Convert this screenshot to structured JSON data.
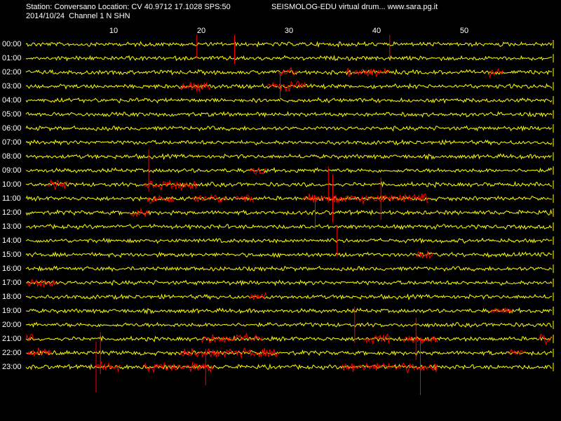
{
  "header": {
    "station_line": "Station: Conversano Location: CV 40.9712 17.1028 SPS:50",
    "site_line": "SEISMOLOG-EDU virtual drum... www.sara.pg.it",
    "date_line": "2014/10/24  Channel 1 N SHN"
  },
  "colors": {
    "background": "#000000",
    "trace_normal": "#FFFF00",
    "trace_event": "#FF0000",
    "text": "#FFFFFF"
  },
  "chart_data": {
    "type": "line",
    "xlabel": "",
    "ylabel": "",
    "x_unit": "minute",
    "xlim": [
      0,
      60
    ],
    "x_ticks": [
      10,
      20,
      30,
      40,
      50
    ],
    "x_tick_labels": [
      "10",
      "20",
      "30",
      "40",
      "50"
    ],
    "hour_labels": [
      "00:00",
      "01:00",
      "02:00",
      "03:00",
      "04:00",
      "05:00",
      "06:00",
      "07:00",
      "08:00",
      "09:00",
      "10:00",
      "11:00",
      "12:00",
      "13:00",
      "14:00",
      "15:00",
      "16:00",
      "17:00",
      "18:00",
      "19:00",
      "20:00",
      "21:00",
      "22:00",
      "23:00"
    ],
    "grid": false,
    "event_segments": [
      {
        "hour": 2,
        "start": 28.8,
        "end": 31.0
      },
      {
        "hour": 2,
        "start": 36.5,
        "end": 41.5
      },
      {
        "hour": 2,
        "start": 52.8,
        "end": 54.5
      },
      {
        "hour": 3,
        "start": 17.6,
        "end": 21.0
      },
      {
        "hour": 3,
        "start": 27.5,
        "end": 32.0
      },
      {
        "hour": 9,
        "start": 25.5,
        "end": 27.5
      },
      {
        "hour": 10,
        "start": 2.5,
        "end": 4.8
      },
      {
        "hour": 10,
        "start": 13.5,
        "end": 19.5
      },
      {
        "hour": 11,
        "start": 13.8,
        "end": 17.0
      },
      {
        "hour": 11,
        "start": 19.0,
        "end": 23.0
      },
      {
        "hour": 11,
        "start": 23.8,
        "end": 26.0
      },
      {
        "hour": 11,
        "start": 31.5,
        "end": 46.0
      },
      {
        "hour": 12,
        "start": 11.8,
        "end": 14.0
      },
      {
        "hour": 15,
        "start": 44.5,
        "end": 46.5
      },
      {
        "hour": 17,
        "start": 0.0,
        "end": 3.5
      },
      {
        "hour": 18,
        "start": 25.5,
        "end": 27.5
      },
      {
        "hour": 19,
        "start": 53.0,
        "end": 55.5
      },
      {
        "hour": 21,
        "start": 0.0,
        "end": 1.0
      },
      {
        "hour": 21,
        "start": 20.0,
        "end": 27.0
      },
      {
        "hour": 21,
        "start": 38.5,
        "end": 41.5
      },
      {
        "hour": 21,
        "start": 43.0,
        "end": 47.0
      },
      {
        "hour": 21,
        "start": 58.5,
        "end": 60.0
      },
      {
        "hour": 22,
        "start": 0.0,
        "end": 3.0
      },
      {
        "hour": 22,
        "start": 17.5,
        "end": 29.0
      },
      {
        "hour": 22,
        "start": 55.0,
        "end": 57.0
      },
      {
        "hour": 23,
        "start": 8.0,
        "end": 10.8
      },
      {
        "hour": 23,
        "start": 13.5,
        "end": 21.5
      },
      {
        "hour": 23,
        "start": 36.0,
        "end": 44.5
      },
      {
        "hour": 23,
        "start": 44.5,
        "end": 47.0
      }
    ],
    "spikes": [
      {
        "hour": 0,
        "minute": 23.8,
        "amplitude": 28
      },
      {
        "hour": 0,
        "minute": 19.5,
        "amplitude": 20
      },
      {
        "hour": 0,
        "minute": 41.5,
        "amplitude": 18
      },
      {
        "hour": 3,
        "minute": 29.0,
        "amplitude": 22
      },
      {
        "hour": 9,
        "minute": 14.0,
        "amplitude": 30
      },
      {
        "hour": 10,
        "minute": 34.5,
        "amplitude": 26
      },
      {
        "hour": 11,
        "minute": 35.0,
        "amplitude": 34
      },
      {
        "hour": 11,
        "minute": 40.5,
        "amplitude": 30
      },
      {
        "hour": 12,
        "minute": 33.0,
        "amplitude": 24
      },
      {
        "hour": 14,
        "minute": 35.5,
        "amplitude": 22
      },
      {
        "hour": 20,
        "minute": 37.5,
        "amplitude": 26
      },
      {
        "hour": 21,
        "minute": 44.5,
        "amplitude": 30
      },
      {
        "hour": 22,
        "minute": 8.5,
        "amplitude": 30
      },
      {
        "hour": 23,
        "minute": 45.0,
        "amplitude": 40
      },
      {
        "hour": 23,
        "minute": 8.0,
        "amplitude": 36
      },
      {
        "hour": 23,
        "minute": 20.5,
        "amplitude": 26
      }
    ]
  }
}
